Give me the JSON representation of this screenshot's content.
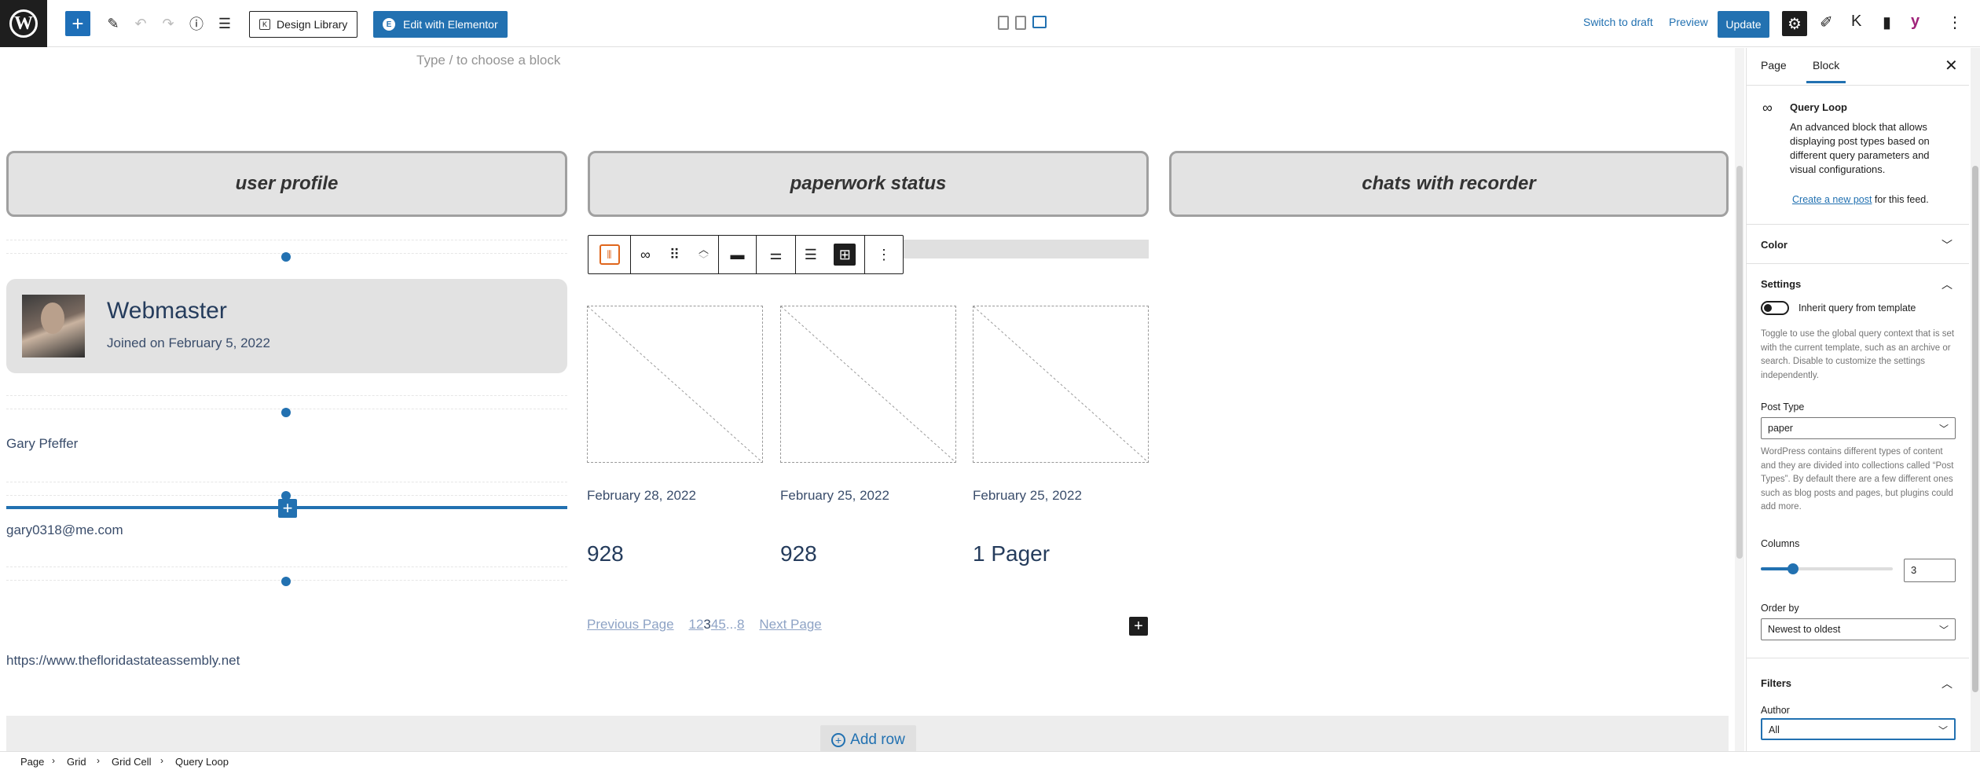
{
  "toolbar": {
    "design_library": "Design Library",
    "edit_elementor": "Edit with Elementor",
    "switch_to_draft": "Switch to draft",
    "preview": "Preview",
    "update": "Update"
  },
  "canvas": {
    "placeholder": "Type / to choose a block",
    "headers": [
      "user profile",
      "paperwork status",
      "chats with recorder"
    ],
    "profile": {
      "name": "Webmaster",
      "joined": "Joined on February 5, 2022",
      "full_name": "Gary Pfeffer",
      "email": "gary0318@me.com",
      "website": "https://www.thefloridastateassembly.net"
    },
    "posts": [
      {
        "date": "February 28, 2022",
        "title": "928"
      },
      {
        "date": "February 25, 2022",
        "title": "928"
      },
      {
        "date": "February 25, 2022",
        "title": "1 Pager"
      }
    ],
    "pagination": {
      "previous": "Previous Page",
      "pages": [
        "1",
        "2",
        "3",
        "4",
        "5",
        "...",
        "8"
      ],
      "next": "Next Page"
    },
    "add_row": "Add row"
  },
  "sidebar": {
    "tabs": [
      "Page",
      "Block"
    ],
    "block_title": "Query Loop",
    "block_desc": "An advanced block that allows displaying post types based on different query parameters and visual configurations.",
    "create_link": "Create a new post",
    "create_suffix": " for this feed.",
    "color_panel": "Color",
    "settings_panel": "Settings",
    "inherit_label": "Inherit query from template",
    "inherit_help": "Toggle to use the global query context that is set with the current template, such as an archive or search. Disable to customize the settings independently.",
    "post_type_label": "Post Type",
    "post_type_value": "paper",
    "post_type_help": "WordPress contains different types of content and they are divided into collections called “Post Types”. By default there are a few different ones such as blog posts and pages, but plugins could add more.",
    "columns_label": "Columns",
    "columns_value": "3",
    "columns_level": 3,
    "order_label": "Order by",
    "order_value": "Newest to oldest",
    "filters_panel": "Filters",
    "author_label": "Author",
    "author_value": "All"
  },
  "breadcrumb": [
    "Page",
    "Grid",
    "Grid Cell",
    "Query Loop"
  ],
  "colors": {
    "accent": "#2271b1",
    "dark": "#1e1e1e"
  }
}
